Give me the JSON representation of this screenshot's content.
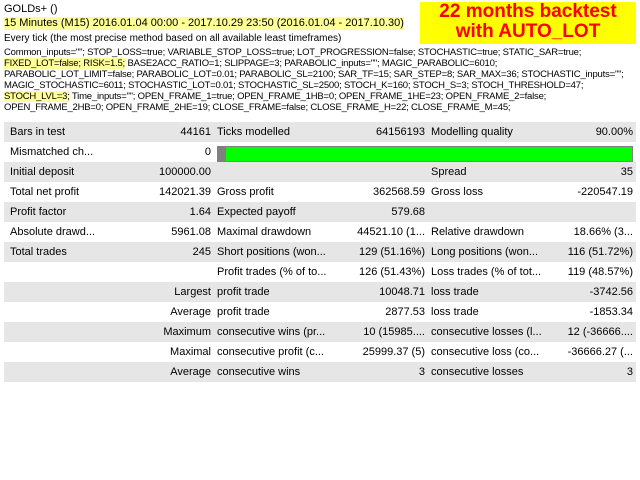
{
  "header": {
    "expert": "GOLDs+ ()",
    "period": "15 Minutes (M15) 2016.01.04 00:00 - 2017.10.29 23:50 (2016.01.04 - 2017.10.30)",
    "model": "Every tick (the most precise method based on all available least timeframes)"
  },
  "banner": {
    "line1": "22 months backtest",
    "line2": "with AUTO_LOT",
    "bg_color": "#ffff00",
    "text_color": "#ff0000"
  },
  "inputs": {
    "line1": "Common_inputs=\"\"; STOP_LOSS=true; VARIABLE_STOP_LOSS=true; LOT_PROGRESSION=false; STOCHASTIC=true; STATIC_SAR=true;",
    "line2_hl": "FIXED_LOT=false; RISK=1.5;",
    "line2_rest": " BASE2ACC_RATIO=1; SLIPPAGE=3; PARABOLIC_inputs=\"\"; MAGIC_PARABOLIC=6010;",
    "line3": "PARABOLIC_LOT_LIMIT=false; PARABOLIC_LOT=0.01; PARABOLIC_SL=2100; SAR_TF=15; SAR_STEP=8; SAR_MAX=36; STOCHASTIC_inputs=\"\";",
    "line4": "MAGIC_STOCHASTIC=6011; STOCHASTIC_LOT=0.01; STOCHASTIC_SL=2500; STOCH_K=160; STOCH_S=3; STOCH_THRESHOLD=47;",
    "line5_hl": "STOCH_LVL=3;",
    "line5_rest": " Time_inputs=\"\"; OPEN_FRAME_1=true; OPEN_FRAME_1HB=0; OPEN_FRAME_1HE=23; OPEN_FRAME_2=false;",
    "line6": "OPEN_FRAME_2HB=0; OPEN_FRAME_2HE=19; CLOSE_FRAME=false; CLOSE_FRAME_H=22; CLOSE_FRAME_M=45;"
  },
  "report": {
    "bars_label": "Bars in test",
    "bars_value": "44161",
    "ticks_label": "Ticks modelled",
    "ticks_value": "64156193",
    "quality_label": "Modelling quality",
    "quality_value": "90.00%",
    "mismatched_label": "Mismatched ch...",
    "mismatched_value": "0",
    "quality_fraction": 0.9,
    "quality_bar_color": "#00ff00",
    "initial_label": "Initial deposit",
    "initial_value": "100000.00",
    "spread_label": "Spread",
    "spread_value": "35",
    "netprofit_label": "Total net profit",
    "netprofit_value": "142021.39",
    "grossprofit_label": "Gross profit",
    "grossprofit_value": "362568.59",
    "grossloss_label": "Gross loss",
    "grossloss_value": "-220547.19",
    "pf_label": "Profit factor",
    "pf_value": "1.64",
    "payoff_label": "Expected payoff",
    "payoff_value": "579.68",
    "absdd_label": "Absolute drawd...",
    "absdd_value": "5961.08",
    "maxdd_label": "Maximal drawdown",
    "maxdd_value": "44521.10 (1...",
    "reldd_label": "Relative drawdown",
    "reldd_value": "18.66% (3...",
    "trades_label": "Total trades",
    "trades_value": "245",
    "short_label": "Short positions (won...",
    "short_value": "129 (51.16%)",
    "long_label": "Long positions (won...",
    "long_value": "116 (51.72%)",
    "ptrades_label": "Profit trades (% of to...",
    "ptrades_value": "126 (51.43%)",
    "ltrades_label": "Loss trades (% of tot...",
    "ltrades_value": "119 (48.57%)",
    "largest_label": "Largest",
    "largest_p_label": "profit trade",
    "largest_p_value": "10048.71",
    "largest_l_label": "loss trade",
    "largest_l_value": "-3742.56",
    "average_label": "Average",
    "average_p_label": "profit trade",
    "average_p_value": "2877.53",
    "average_l_label": "loss trade",
    "average_l_value": "-1853.34",
    "maximum_label": "Maximum",
    "maximum_p_label": "consecutive wins (pr...",
    "maximum_p_value": "10 (15985....",
    "maximum_l_label": "consecutive losses (l...",
    "maximum_l_value": "12 (-36666....",
    "maximal_label": "Maximal",
    "maximal_p_label": "consecutive profit (c...",
    "maximal_p_value": "25999.37 (5)",
    "maximal_l_label": "consecutive loss (co...",
    "maximal_l_value": "-36666.27 (...",
    "avgc_label": "Average",
    "avgc_p_label": "consecutive wins",
    "avgc_p_value": "3",
    "avgc_l_label": "consecutive losses",
    "avgc_l_value": "3"
  }
}
